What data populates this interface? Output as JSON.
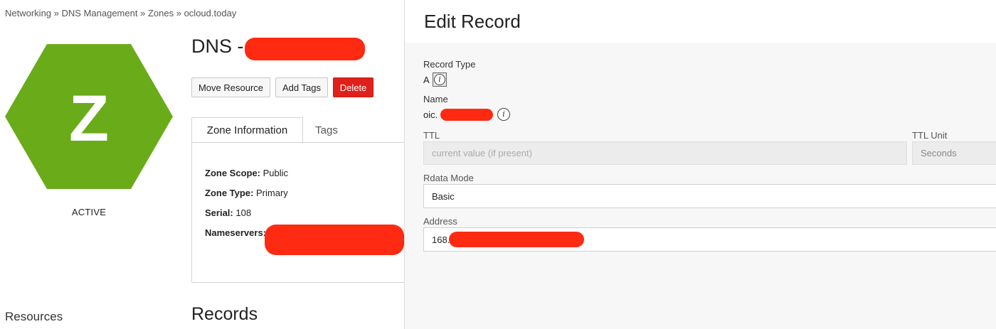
{
  "breadcrumb": {
    "items": [
      "Networking",
      "DNS Management",
      "Zones",
      "ocloud.today"
    ],
    "separator": "»"
  },
  "zone": {
    "icon_letter": "Z",
    "icon_color": "#6aab1a",
    "status": "ACTIVE",
    "title_prefix": "DNS -"
  },
  "toolbar": {
    "move_label": "Move Resource",
    "tags_label": "Add Tags",
    "delete_label": "Delete",
    "delete_color": "#e0201b"
  },
  "tabs": [
    {
      "label": "Zone Information",
      "active": true
    },
    {
      "label": "Tags",
      "active": false
    }
  ],
  "zone_info": {
    "scope_label": "Zone Scope:",
    "scope_value": "Public",
    "type_label": "Zone Type:",
    "type_value": "Primary",
    "serial_label": "Serial:",
    "serial_value": "108",
    "nameservers_label": "Nameservers:"
  },
  "sidebar": {
    "resources_label": "Resources"
  },
  "records": {
    "heading": "Records"
  },
  "edit_record": {
    "title": "Edit Record",
    "record_type_label": "Record Type",
    "record_type_value": "A",
    "name_label": "Name",
    "name_value_visible": "oic.",
    "ttl_label": "TTL",
    "ttl_placeholder": "current value (if present)",
    "ttl_unit_label": "TTL Unit",
    "ttl_unit_value": "Seconds",
    "rdata_mode_label": "Rdata Mode",
    "rdata_mode_value": "Basic",
    "address_label": "Address",
    "address_value_visible": "168."
  },
  "redaction_color": "#ff2a12",
  "icons": [
    "info-icon"
  ]
}
